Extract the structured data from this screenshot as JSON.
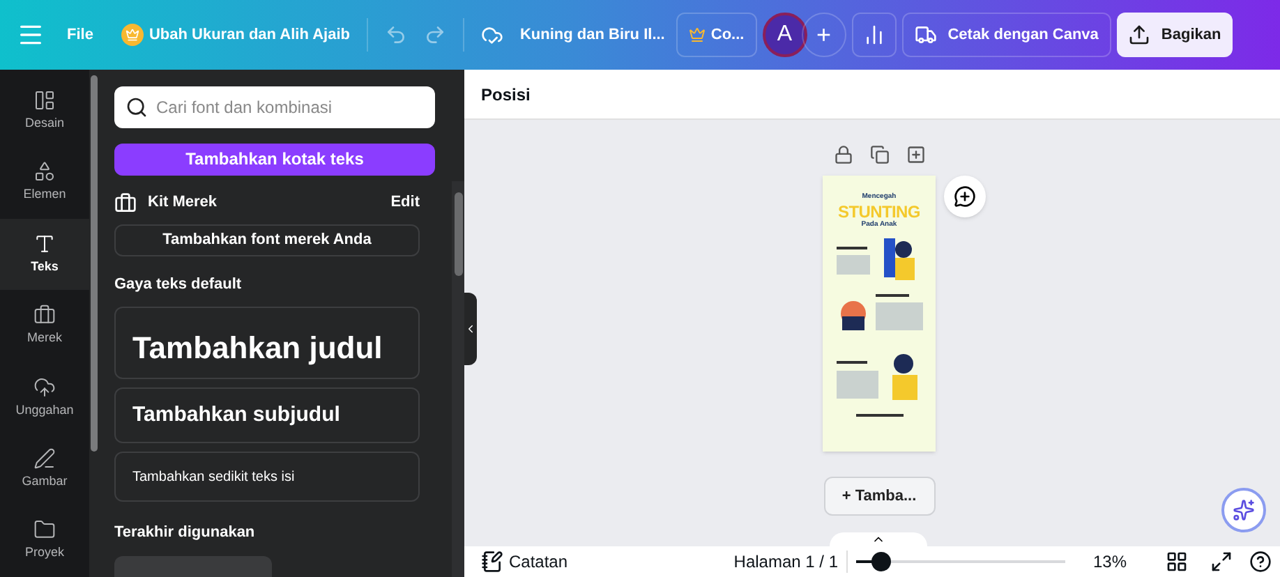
{
  "topbar": {
    "menu_label": "File",
    "promo": "Ubah Ukuran dan Alih Ajaib",
    "design_title": "Kuning dan Biru Il...",
    "team": "Co...",
    "avatar": "A",
    "add": "+",
    "print": "Cetak dengan Canva",
    "share": "Bagikan"
  },
  "rail": [
    {
      "label": "Desain",
      "selected": false
    },
    {
      "label": "Elemen",
      "selected": false
    },
    {
      "label": "Teks",
      "selected": true
    },
    {
      "label": "Merek",
      "selected": false
    },
    {
      "label": "Unggahan",
      "selected": false
    },
    {
      "label": "Gambar",
      "selected": false
    },
    {
      "label": "Proyek",
      "selected": false
    }
  ],
  "panel": {
    "search": {
      "placeholder": "Cari font dan kombinasi"
    },
    "add_textbox": "Tambahkan kotak teks",
    "brand_kit": "Kit Merek",
    "edit": "Edit",
    "add_brand_font": "Tambahkan font merek Anda",
    "default_styles_heading": "Gaya teks default",
    "styles": [
      {
        "kind": "heading",
        "label": "Tambahkan judul"
      },
      {
        "kind": "subheading",
        "label": "Tambahkan subjudul"
      },
      {
        "kind": "body",
        "label": "Tambahkan sedikit teks isi"
      }
    ],
    "recent_heading": "Terakhir digunakan"
  },
  "canvas": {
    "toolbar_label": "Posisi",
    "page": {
      "kicker": "Mencegah",
      "title": "STUNTING",
      "subtitle": "Pada Anak"
    },
    "add_page": "+ Tamba..."
  },
  "footer": {
    "notes": "Catatan",
    "page_counter": "Halaman 1 / 1",
    "zoom": {
      "level": 0.12
    },
    "zoom_reading": "13%"
  }
}
